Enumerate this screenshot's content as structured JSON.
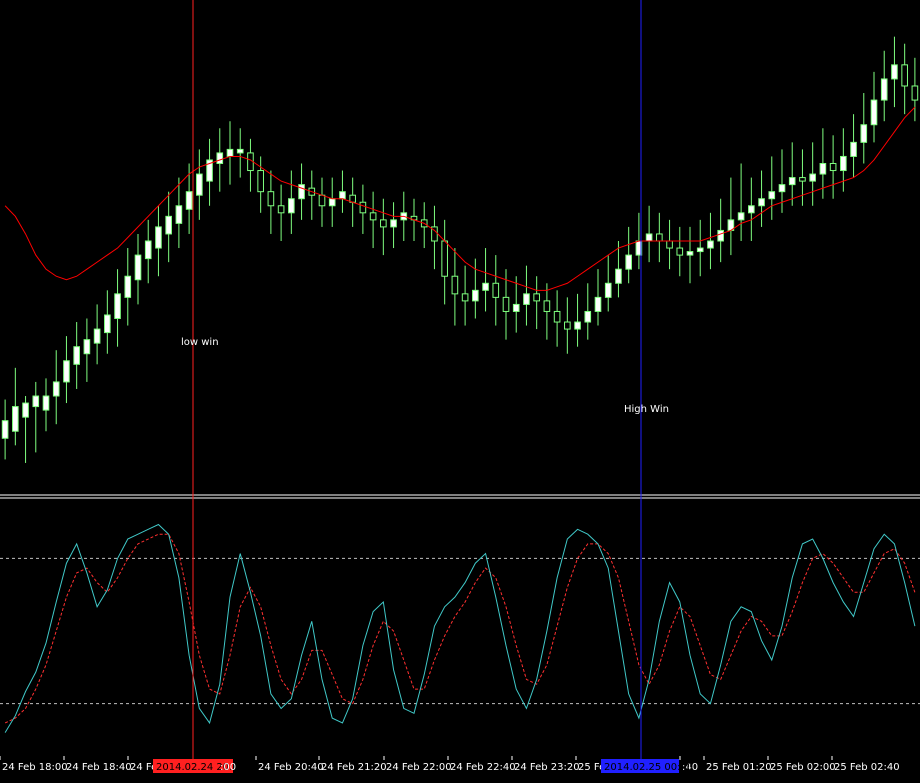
{
  "colors": {
    "background": "#000000",
    "candle": "#7fff7f",
    "candle_fill": "#ffffff",
    "moving_average": "#ff0000",
    "stoch_main": "#40c8c8",
    "stoch_signal": "#ff3030",
    "separator": "#ffffff",
    "level_line": "#c0c0c0",
    "crosshair_red": "#ff2020",
    "crosshair_blue": "#2020ff"
  },
  "annotations": [
    {
      "text": "low win",
      "color": "#ffffff"
    },
    {
      "text": "High Win",
      "color": "#ffffff"
    }
  ],
  "time_axis": {
    "ticks": [
      "24 Feb 18:00",
      "24 Feb 18:40",
      "24 Feb",
      "24 Feb 20:40",
      "24 Feb 21:20",
      "24 Feb 22:00",
      "24 Feb 22:40",
      "24 Feb 23:20",
      "25 Feb",
      ":40",
      "25 Feb 01:20",
      "25 Feb 02:00",
      "25 Feb 02:40"
    ],
    "highlight_red": "2014.02.24 20:00",
    "highlight_red_tail": ":00",
    "highlight_blue": "2014.02.25 00:40"
  },
  "chart_data": {
    "type": "candlestick",
    "price_panel": {
      "candles": [
        [
          4,
          9,
          -2,
          15
        ],
        [
          6,
          13,
          2,
          24
        ],
        [
          10,
          14,
          -3,
          16
        ],
        [
          13,
          16,
          0,
          20
        ],
        [
          12,
          16,
          6,
          21
        ],
        [
          16,
          20,
          8,
          29
        ],
        [
          20,
          26,
          14,
          33
        ],
        [
          25,
          30,
          18,
          37
        ],
        [
          28,
          32,
          20,
          38
        ],
        [
          31,
          35,
          25,
          42
        ],
        [
          34,
          39,
          28,
          46
        ],
        [
          38,
          45,
          30,
          52
        ],
        [
          44,
          50,
          36,
          58
        ],
        [
          49,
          56,
          42,
          62
        ],
        [
          55,
          60,
          48,
          66
        ],
        [
          58,
          64,
          50,
          70
        ],
        [
          62,
          67,
          54,
          74
        ],
        [
          65,
          70,
          58,
          78
        ],
        [
          69,
          74,
          62,
          82
        ],
        [
          73,
          79,
          66,
          86
        ],
        [
          77,
          83,
          70,
          89
        ],
        [
          82,
          85,
          74,
          92
        ],
        [
          84,
          86,
          76,
          94
        ],
        [
          85,
          86,
          78,
          92
        ],
        [
          85,
          80,
          74,
          89
        ],
        [
          80,
          74,
          68,
          84
        ],
        [
          74,
          70,
          62,
          80
        ],
        [
          70,
          68,
          60,
          76
        ],
        [
          68,
          72,
          62,
          80
        ],
        [
          72,
          76,
          66,
          82
        ],
        [
          75,
          73,
          66,
          80
        ],
        [
          73,
          70,
          64,
          78
        ],
        [
          70,
          72,
          64,
          78
        ],
        [
          72,
          74,
          68,
          80
        ],
        [
          73,
          71,
          64,
          78
        ],
        [
          71,
          68,
          62,
          76
        ],
        [
          68,
          66,
          58,
          74
        ],
        [
          66,
          64,
          56,
          72
        ],
        [
          64,
          66,
          58,
          71
        ],
        [
          66,
          68,
          60,
          74
        ],
        [
          67,
          66,
          60,
          72
        ],
        [
          66,
          64,
          58,
          71
        ],
        [
          64,
          60,
          52,
          70
        ],
        [
          60,
          50,
          42,
          66
        ],
        [
          50,
          45,
          36,
          58
        ],
        [
          45,
          43,
          36,
          53
        ],
        [
          43,
          46,
          38,
          55
        ],
        [
          46,
          48,
          40,
          58
        ],
        [
          48,
          44,
          36,
          56
        ],
        [
          44,
          40,
          32,
          52
        ],
        [
          40,
          42,
          34,
          50
        ],
        [
          42,
          45,
          36,
          53
        ],
        [
          45,
          43,
          35,
          50
        ],
        [
          43,
          40,
          32,
          48
        ],
        [
          40,
          37,
          30,
          46
        ],
        [
          37,
          35,
          28,
          44
        ],
        [
          35,
          37,
          30,
          45
        ],
        [
          37,
          40,
          32,
          48
        ],
        [
          40,
          44,
          36,
          52
        ],
        [
          44,
          48,
          40,
          56
        ],
        [
          48,
          52,
          44,
          60
        ],
        [
          52,
          56,
          48,
          64
        ],
        [
          56,
          60,
          52,
          68
        ],
        [
          60,
          62,
          54,
          70
        ],
        [
          62,
          60,
          54,
          68
        ],
        [
          60,
          58,
          52,
          66
        ],
        [
          58,
          56,
          50,
          64
        ],
        [
          56,
          57,
          48,
          64
        ],
        [
          57,
          58,
          50,
          66
        ],
        [
          58,
          60,
          52,
          68
        ],
        [
          60,
          63,
          54,
          72
        ],
        [
          63,
          66,
          56,
          78
        ],
        [
          66,
          68,
          60,
          82
        ],
        [
          68,
          70,
          60,
          78
        ],
        [
          70,
          72,
          64,
          80
        ],
        [
          72,
          74,
          66,
          84
        ],
        [
          74,
          76,
          68,
          86
        ],
        [
          76,
          78,
          70,
          88
        ],
        [
          78,
          77,
          70,
          86
        ],
        [
          77,
          79,
          70,
          88
        ],
        [
          79,
          82,
          72,
          92
        ],
        [
          82,
          80,
          72,
          90
        ],
        [
          80,
          84,
          74,
          92
        ],
        [
          84,
          88,
          78,
          96
        ],
        [
          88,
          93,
          82,
          102
        ],
        [
          93,
          100,
          88,
          108
        ],
        [
          100,
          106,
          94,
          114
        ],
        [
          106,
          110,
          98,
          118
        ],
        [
          110,
          104,
          96,
          116
        ],
        [
          104,
          100,
          94,
          112
        ]
      ],
      "ma": [
        70,
        67,
        62,
        56,
        52,
        50,
        49,
        50,
        52,
        54,
        56,
        58,
        61,
        64,
        67,
        70,
        73,
        76,
        79,
        81,
        82,
        83,
        84,
        84,
        83,
        81,
        79,
        77,
        76,
        75,
        74,
        73,
        72,
        72,
        71,
        70,
        69,
        68,
        67,
        67,
        66,
        65,
        63,
        60,
        57,
        54,
        52,
        51,
        50,
        49,
        48,
        47,
        46,
        46,
        47,
        48,
        50,
        52,
        54,
        56,
        58,
        59,
        60,
        60,
        60,
        60,
        60,
        60,
        60,
        61,
        62,
        63,
        65,
        66,
        68,
        70,
        71,
        72,
        73,
        74,
        75,
        76,
        77,
        78,
        80,
        83,
        87,
        91,
        95,
        98
      ],
      "ylim": [
        -5,
        125
      ]
    },
    "oscillator_panel": {
      "main": [
        8,
        15,
        25,
        33,
        45,
        62,
        78,
        86,
        74,
        60,
        67,
        80,
        88,
        90,
        92,
        94,
        90,
        72,
        40,
        18,
        12,
        28,
        64,
        82,
        66,
        48,
        24,
        18,
        22,
        40,
        54,
        30,
        14,
        12,
        22,
        44,
        58,
        62,
        34,
        18,
        16,
        32,
        52,
        60,
        64,
        70,
        78,
        82,
        64,
        44,
        26,
        18,
        30,
        50,
        72,
        88,
        92,
        90,
        86,
        76,
        50,
        24,
        14,
        30,
        54,
        70,
        62,
        40,
        24,
        20,
        36,
        54,
        60,
        58,
        46,
        38,
        52,
        72,
        86,
        88,
        80,
        70,
        62,
        56,
        70,
        84,
        90,
        86,
        70,
        52
      ],
      "signal": [
        12,
        14,
        18,
        26,
        36,
        50,
        64,
        74,
        76,
        70,
        66,
        72,
        80,
        86,
        88,
        90,
        90,
        82,
        62,
        40,
        26,
        24,
        40,
        60,
        68,
        60,
        44,
        30,
        24,
        30,
        42,
        42,
        32,
        22,
        20,
        30,
        44,
        54,
        50,
        38,
        26,
        26,
        38,
        48,
        56,
        62,
        70,
        76,
        72,
        60,
        44,
        30,
        28,
        36,
        52,
        68,
        80,
        86,
        86,
        82,
        72,
        54,
        36,
        28,
        36,
        50,
        60,
        56,
        44,
        32,
        30,
        40,
        50,
        56,
        54,
        48,
        48,
        58,
        70,
        80,
        82,
        78,
        72,
        66,
        66,
        74,
        82,
        84,
        78,
        66
      ],
      "levels": [
        80,
        20
      ],
      "ylim": [
        0,
        100
      ]
    }
  }
}
